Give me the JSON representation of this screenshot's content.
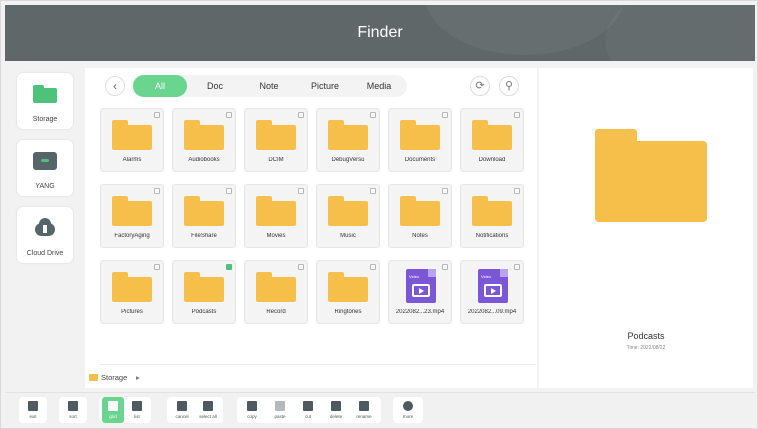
{
  "header": {
    "title": "Finder"
  },
  "sidebar": {
    "items": [
      {
        "label": "Storage",
        "icon": "folder-icon"
      },
      {
        "label": "YANG",
        "icon": "usb-drive-icon"
      },
      {
        "label": "Cloud Drive",
        "icon": "cloud-upload-icon"
      }
    ]
  },
  "filter_tabs": [
    "All",
    "Doc",
    "Note",
    "Picture",
    "Media"
  ],
  "active_tab": "All",
  "toolbar_icons": {
    "back": "‹",
    "refresh": "⟳",
    "search": "⚲"
  },
  "files": [
    {
      "name": "Alarms",
      "type": "folder",
      "checked": false
    },
    {
      "name": "Audiobooks",
      "type": "folder",
      "checked": false
    },
    {
      "name": "DCIM",
      "type": "folder",
      "checked": false
    },
    {
      "name": "DebugVersu",
      "type": "folder",
      "checked": false
    },
    {
      "name": "Documents",
      "type": "folder",
      "checked": false
    },
    {
      "name": "Download",
      "type": "folder",
      "checked": false
    },
    {
      "name": "FactoryAging",
      "type": "folder",
      "checked": false
    },
    {
      "name": "FileShare",
      "type": "folder",
      "checked": false
    },
    {
      "name": "Movies",
      "type": "folder",
      "checked": false
    },
    {
      "name": "Music",
      "type": "folder",
      "checked": false
    },
    {
      "name": "Notes",
      "type": "folder",
      "checked": false
    },
    {
      "name": "Notifications",
      "type": "folder",
      "checked": false
    },
    {
      "name": "Pictures",
      "type": "folder",
      "checked": false
    },
    {
      "name": "Podcasts",
      "type": "folder",
      "checked": true
    },
    {
      "name": "Record",
      "type": "folder",
      "checked": false
    },
    {
      "name": "Ringtones",
      "type": "folder",
      "checked": false
    },
    {
      "name": "2022082...23.mp4",
      "type": "video",
      "checked": false
    },
    {
      "name": "2022082...09.mp4",
      "type": "video",
      "checked": false
    }
  ],
  "video_badge": "Video",
  "path": {
    "label": "Storage",
    "arrow": "▸"
  },
  "preview": {
    "name": "Podcasts",
    "date": "Time: 2022/08/22"
  },
  "bottom_toolbar": [
    {
      "label": "exit",
      "icon": "exit-icon"
    },
    {
      "label": "sort",
      "icon": "sort-icon"
    },
    {
      "label": "grid",
      "icon": "grid-view-icon",
      "active": true
    },
    {
      "label": "list",
      "icon": "list-view-icon"
    },
    {
      "label": "cancel",
      "icon": "cancel-select-icon"
    },
    {
      "label": "select all",
      "icon": "select-all-icon"
    },
    {
      "label": "copy",
      "icon": "copy-icon"
    },
    {
      "label": "paste",
      "icon": "paste-icon",
      "disabled": true
    },
    {
      "label": "cut",
      "icon": "cut-icon"
    },
    {
      "label": "delete",
      "icon": "delete-icon"
    },
    {
      "label": "rename",
      "icon": "rename-icon"
    },
    {
      "label": "more",
      "icon": "more-icon"
    }
  ],
  "colors": {
    "accent": "#69d58e",
    "folder": "#f6bf4a",
    "video": "#7b57d6",
    "header": "#5f6769"
  }
}
